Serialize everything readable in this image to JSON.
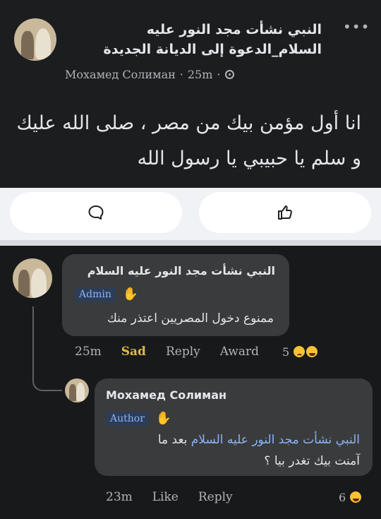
{
  "post": {
    "more_icon": "more-dots-icon",
    "author_title": "النبي نشأت مجد النور عليه السلام_الدعوة إلى الديانة الجديدة",
    "commenter_name": "Мохамед Солиман",
    "time": "25m",
    "separator": "·",
    "privacy_icon": "globe-icon",
    "body": "انا أول مؤمن بيك من مصر ، صلى الله عليك و سلم يا حبيبي يا رسول الله"
  },
  "actions": {
    "comment_icon": "comment-icon",
    "like_icon": "thumbs-up-icon"
  },
  "comment1": {
    "name": "النبي نشأت مجد النور عليه السلام",
    "badge": "Admin",
    "badge_icon": "wave-icon",
    "text": "ممنوع دخول المصريين اعتذر منك",
    "time": "25m",
    "reaction_label": "Sad",
    "reply": "Reply",
    "award": "Award",
    "reaction_count": "5"
  },
  "comment2": {
    "name": "Мохамед Солиман",
    "badge": "Author",
    "badge_icon": "wave-icon",
    "mention": "النبي نشأت مجد النور عليه السلام",
    "text_after_mention": " بعد ما",
    "text_line2": "آمنت بيك تغدر بيا ؟",
    "time": "23m",
    "like": "Like",
    "reply": "Reply",
    "reaction_count": "6"
  },
  "colors": {
    "dark_bg": "#18191a",
    "bubble": "#3a3b3c",
    "link_blue": "#8ab4f8",
    "sad_yellow": "#e0b94a"
  }
}
